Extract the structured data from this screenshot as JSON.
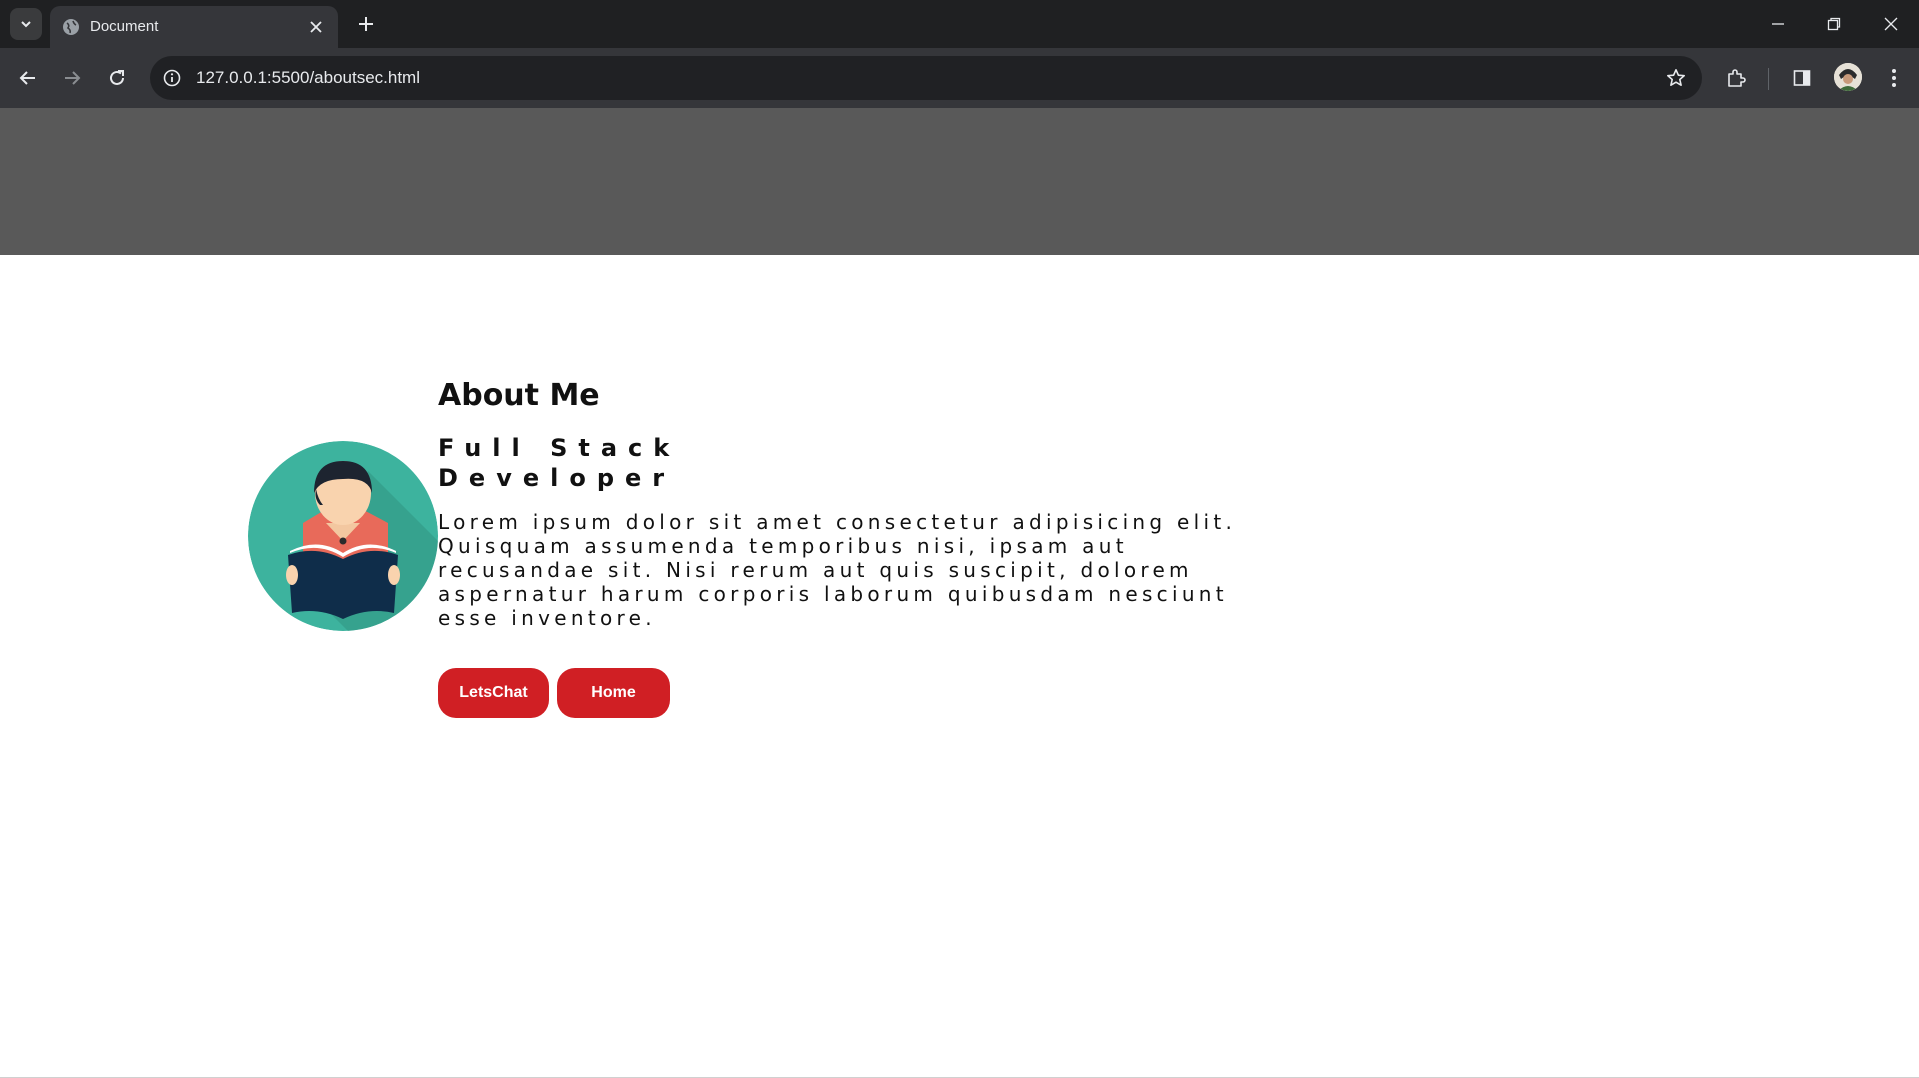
{
  "browser": {
    "tab_title": "Document",
    "url": "127.0.0.1:5500/aboutsec.html"
  },
  "about": {
    "heading": "About Me",
    "role": "Full Stack Developer",
    "description": "Lorem ipsum dolor sit amet consectetur adipisicing elit. Quisquam assumenda temporibus nisi, ipsam aut recusandae sit. Nisi rerum aut quis suscipit, dolorem aspernatur harum corporis laborum quibusdam nesciunt esse inventore.",
    "buttons": {
      "letschat_label": "LetsChat",
      "home_label": "Home"
    }
  },
  "colors": {
    "header_band": "#595959",
    "button": "#d01f24",
    "avatar_circle": "#3db39e"
  },
  "icons": [
    "tab-search-icon",
    "globe-icon",
    "close-icon",
    "plus-icon",
    "minimize-icon",
    "restore-icon",
    "back-arrow-icon",
    "forward-arrow-icon",
    "reload-icon",
    "info-icon",
    "star-icon",
    "extensions-icon",
    "side-panel-icon",
    "profile-avatar-icon",
    "kebab-menu-icon",
    "reader-avatar-icon"
  ]
}
